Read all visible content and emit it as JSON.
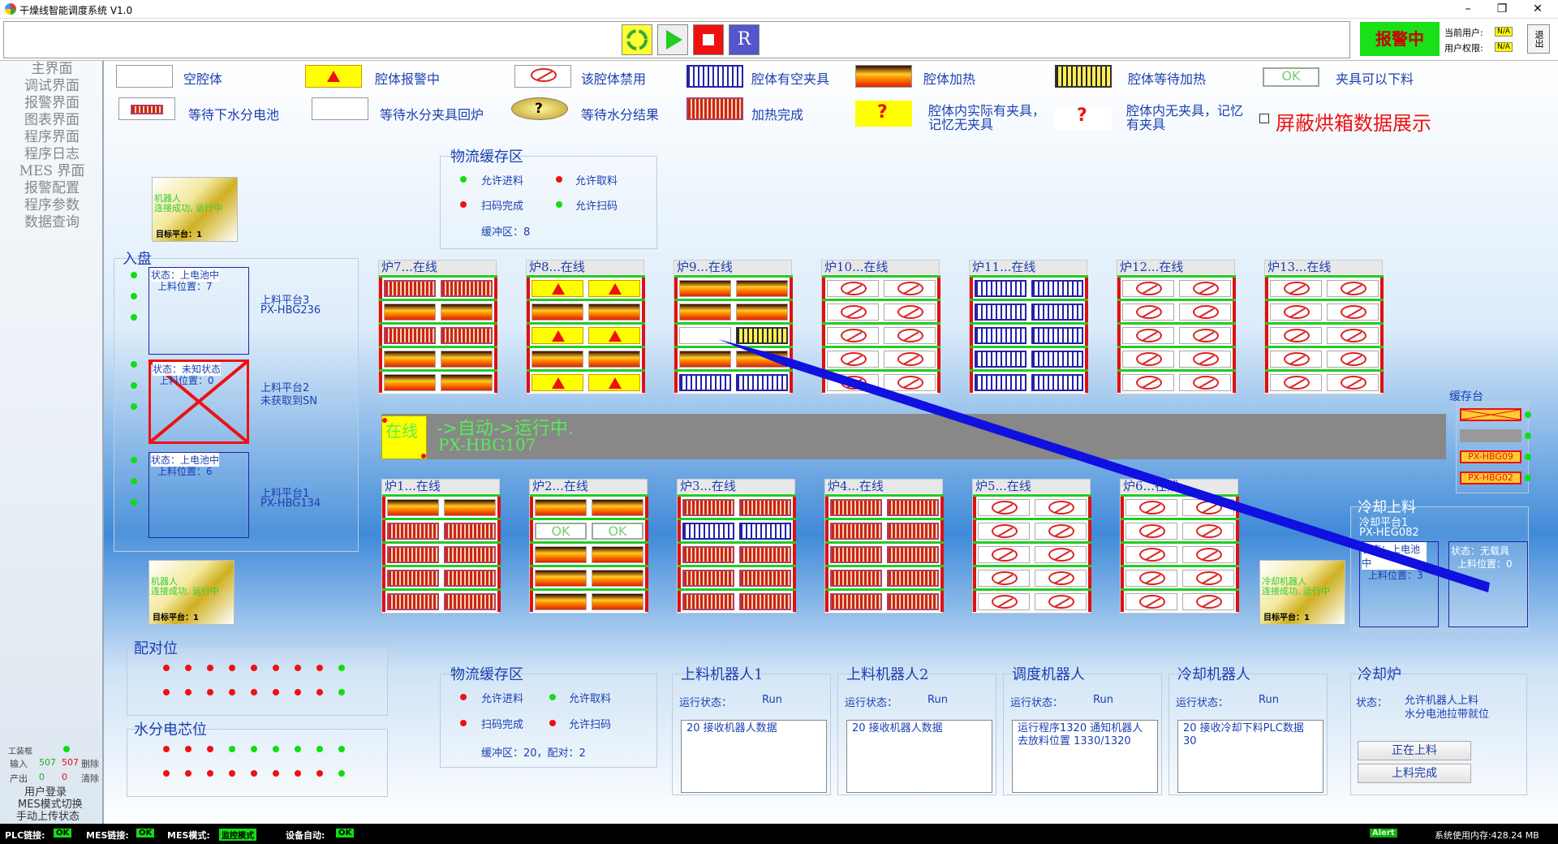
{
  "app": {
    "title": "干燥线智能调度系统 V1.0"
  },
  "window": {
    "min": "–",
    "max": "❐",
    "close": "✕"
  },
  "toolbar": {
    "reset": "R",
    "alarm": "报警中",
    "user_label": "当前用户:",
    "user_value": "N/A",
    "perm_label": "用户权限:",
    "perm_value": "N/A",
    "exit": "退出"
  },
  "nav": [
    "主界面",
    "调试界面",
    "报警界面",
    "图表界面",
    "程序界面",
    "程序日志",
    "MES 界面",
    "报警配置",
    "程序参数",
    "数据查询"
  ],
  "legend": [
    {
      "label": "空腔体",
      "icon": "white"
    },
    {
      "label": "腔体报警中",
      "icon": "alarm"
    },
    {
      "label": "该腔体禁用",
      "icon": "ban"
    },
    {
      "label": "腔体有空夹具",
      "icon": "empty"
    },
    {
      "label": "腔体加热",
      "icon": "fire"
    },
    {
      "label": "腔体等待加热",
      "icon": "wait"
    },
    {
      "label": "夹具可以下料",
      "icon": "ok"
    },
    {
      "label": "等待下水分电池",
      "icon": "done"
    },
    {
      "label": "等待水分夹具回炉",
      "icon": "white"
    },
    {
      "label": "等待水分结果",
      "icon": "question"
    },
    {
      "label": "加热完成",
      "icon": "done"
    },
    {
      "label": "腔体内实际有夹具，记忆无夹具",
      "icon": "qyellow"
    },
    {
      "label": "腔体内无夹具，记忆有夹具",
      "icon": "qwhite"
    }
  ],
  "ok_text": "OK",
  "mask": {
    "label": "屏蔽烘箱数据展示"
  },
  "buffer_top": {
    "title": "物流缓存区",
    "allow_in": "允许进料",
    "allow_out": "允许取料",
    "scan_done": "扫码完成",
    "allow_scan": "允许扫码",
    "count": "缓冲区：8"
  },
  "robot_top": {
    "status": "机器人\n连接成功, 运行中",
    "target": "目标平台：1"
  },
  "robot_bottom": {
    "status": "机器人\n连接成功, 运行中",
    "target": "目标平台：1"
  },
  "robot_right": {
    "status": "冷却机器人\n连接成功, 运行中",
    "target": "目标平台：1"
  },
  "inbound": {
    "title": "入盘",
    "p3": {
      "status": "状态：上电池中",
      "pos": "上料位置：7",
      "name": "上料平台3",
      "code": "PX-HBG236"
    },
    "p2": {
      "status": "状态：未知状态",
      "pos": "上料位置：0",
      "name": "上料平台2",
      "code": "未获取到SN"
    },
    "p1": {
      "status": "状态：上电池中",
      "pos": "上料位置：6",
      "name": "上料平台1",
      "code": "PX-HBG134"
    }
  },
  "furnaces_top": [
    {
      "title": "炉7...在线",
      "rows": [
        [
          "done",
          "done"
        ],
        [
          "fire",
          "fire"
        ],
        [
          "done",
          "done"
        ],
        [
          "fire",
          "fire"
        ],
        [
          "fire",
          "fire"
        ]
      ]
    },
    {
      "title": "炉8...在线",
      "rows": [
        [
          "alarm",
          "alarm"
        ],
        [
          "fire",
          "fire"
        ],
        [
          "alarm",
          "alarm"
        ],
        [
          "fire",
          "fire"
        ],
        [
          "alarm",
          "alarm"
        ]
      ]
    },
    {
      "title": "炉9...在线",
      "rows": [
        [
          "fire",
          "fire"
        ],
        [
          "fire",
          "fire"
        ],
        [
          "white",
          "wait"
        ],
        [
          "fire",
          "fire"
        ],
        [
          "empty",
          "empty"
        ]
      ]
    },
    {
      "title": "炉10...在线",
      "rows": [
        [
          "ban",
          "ban"
        ],
        [
          "ban",
          "ban"
        ],
        [
          "ban",
          "ban"
        ],
        [
          "ban",
          "ban"
        ],
        [
          "ban",
          "ban"
        ]
      ]
    },
    {
      "title": "炉11...在线",
      "rows": [
        [
          "empty",
          "empty"
        ],
        [
          "empty",
          "empty"
        ],
        [
          "empty",
          "empty"
        ],
        [
          "empty",
          "empty"
        ],
        [
          "empty",
          "empty"
        ]
      ]
    },
    {
      "title": "炉12...在线",
      "rows": [
        [
          "ban",
          "ban"
        ],
        [
          "ban",
          "ban"
        ],
        [
          "ban",
          "ban"
        ],
        [
          "ban",
          "ban"
        ],
        [
          "ban",
          "ban"
        ]
      ]
    },
    {
      "title": "炉13...在线",
      "rows": [
        [
          "ban",
          "ban"
        ],
        [
          "ban",
          "ban"
        ],
        [
          "ban",
          "ban"
        ],
        [
          "ban",
          "ban"
        ],
        [
          "ban",
          "ban"
        ]
      ]
    }
  ],
  "furnaces_bottom": [
    {
      "title": "炉1...在线",
      "rows": [
        [
          "fire",
          "fire"
        ],
        [
          "done",
          "done"
        ],
        [
          "done",
          "done"
        ],
        [
          "done",
          "done"
        ],
        [
          "done",
          "done"
        ]
      ]
    },
    {
      "title": "炉2...在线",
      "rows": [
        [
          "fire",
          "fire"
        ],
        [
          "ok",
          "ok"
        ],
        [
          "fire",
          "fire"
        ],
        [
          "fire",
          "fire"
        ],
        [
          "fire",
          "fire"
        ]
      ]
    },
    {
      "title": "炉3...在线",
      "rows": [
        [
          "done",
          "done"
        ],
        [
          "empty",
          "empty"
        ],
        [
          "done",
          "done"
        ],
        [
          "done",
          "done"
        ],
        [
          "done",
          "done"
        ]
      ]
    },
    {
      "title": "炉4...在线",
      "rows": [
        [
          "done",
          "done"
        ],
        [
          "done",
          "done"
        ],
        [
          "done",
          "done"
        ],
        [
          "done",
          "done"
        ],
        [
          "done",
          "done"
        ]
      ]
    },
    {
      "title": "炉5...在线",
      "rows": [
        [
          "ban",
          "ban"
        ],
        [
          "ban",
          "ban"
        ],
        [
          "ban",
          "ban"
        ],
        [
          "ban",
          "ban"
        ],
        [
          "ban",
          "ban"
        ]
      ]
    },
    {
      "title": "炉6...在线",
      "rows": [
        [
          "ban",
          "ban"
        ],
        [
          "ban",
          "ban"
        ],
        [
          "ban",
          "ban"
        ],
        [
          "ban",
          "ban"
        ],
        [
          "ban",
          "ban"
        ]
      ]
    }
  ],
  "rail": {
    "state": "在线",
    "mode": "->自动->运行中.",
    "code": "PX-HBG107"
  },
  "cache": {
    "title": "缓存台",
    "slot3": "PX-HBG09",
    "slot4": "PX-HBG02"
  },
  "cooling_load": {
    "title": "冷却上料",
    "platform": "冷却平台1",
    "code": "PX-HEG082",
    "left_status": "状态：上电池中",
    "left_pos": "上料位置：3",
    "right_status": "状态：无载具",
    "right_pos": "上料位置：0"
  },
  "pairing": {
    "title": "配对位"
  },
  "moisture": {
    "title": "水分电芯位"
  },
  "buffer_bottom": {
    "title": "物流缓存区",
    "allow_in": "允许进料",
    "allow_out": "允许取料",
    "scan_done": "扫码完成",
    "allow_scan": "允许扫码",
    "count": "缓冲区：20，配对：2"
  },
  "robots": [
    {
      "title": "上料机器人1",
      "status_label": "运行状态：",
      "status": "Run",
      "log": "20  接收机器人数据"
    },
    {
      "title": "上料机器人2",
      "status_label": "运行状态：",
      "status": "Run",
      "log": "20  接收机器人数据"
    },
    {
      "title": "调度机器人",
      "status_label": "运行状态：",
      "status": "Run",
      "log": "运行程序1320  通知机器人去放料位置  1330/1320"
    },
    {
      "title": "冷却机器人",
      "status_label": "运行状态：",
      "status": "Run",
      "log": "20   接收冷却下料PLC数据   30"
    }
  ],
  "cooling_furnace": {
    "title": "冷却炉",
    "status_label": "状态：",
    "status": "允许机器人上料\n水分电池拉带就位",
    "btn1": "正在上料",
    "btn2": "上料完成"
  },
  "side_counters": {
    "station": "工装框",
    "input": "输入",
    "in_a": "507",
    "in_b": "507",
    "del": "删除",
    "output": "产出",
    "out_a": "0",
    "out_b": "0",
    "clear": "清除",
    "login": "用户登录",
    "mes_switch": "MES模式切换",
    "manual_upload": "手动上传状态"
  },
  "statusbar": {
    "plc": "PLC链接:",
    "plc_v": "OK",
    "mes": "MES链接:",
    "mes_v": "OK",
    "mesmode": "MES模式:",
    "mesmode_v": "监控模式",
    "auto": "设备自动:",
    "auto_v": "OK",
    "alert": "Alert",
    "mem": "系统使用内存:428.24 MB"
  },
  "colors": {
    "accent": "#1a3fb0",
    "ok_green": "#19e019",
    "alarm_red": "#e11111"
  }
}
